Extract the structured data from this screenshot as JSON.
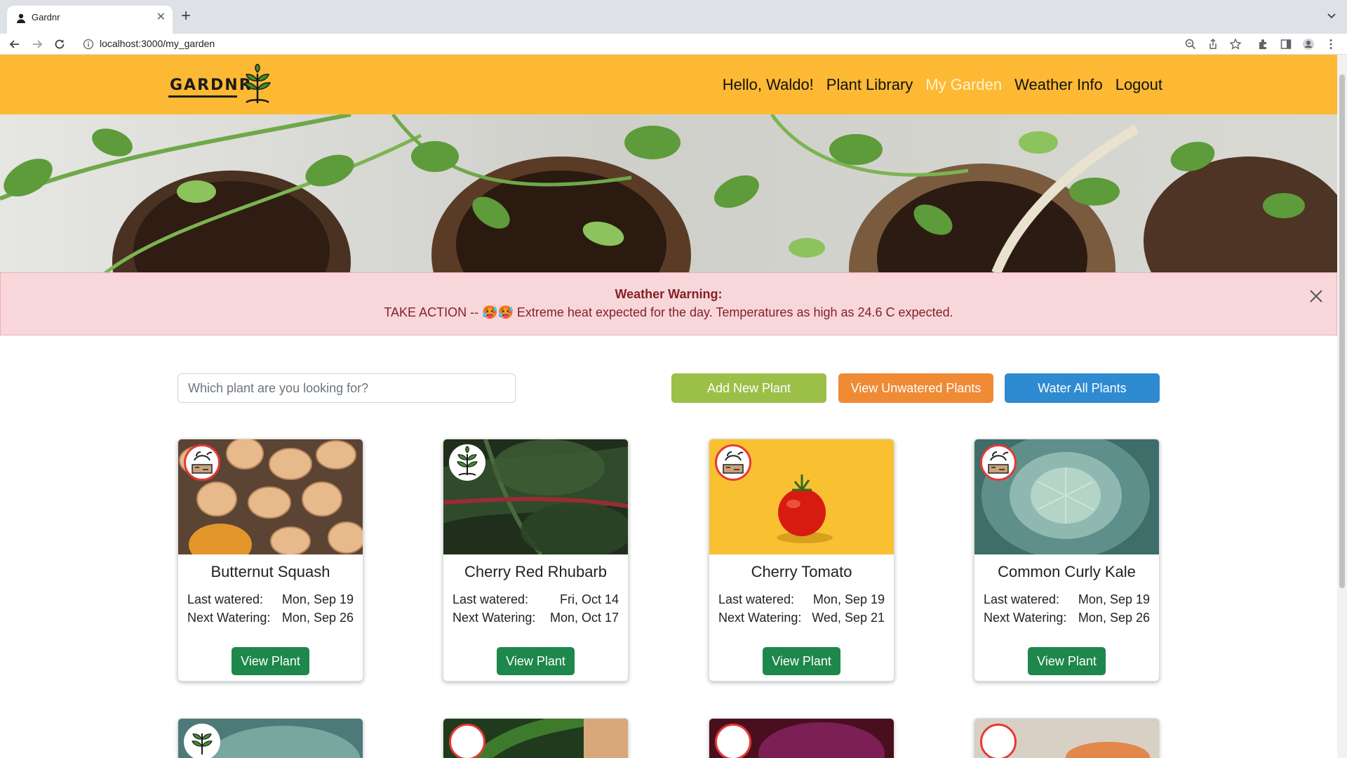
{
  "browser": {
    "tab_title": "Gardnr",
    "url": "localhost:3000/my_garden"
  },
  "navbar": {
    "brand": "GARDNR",
    "links": [
      {
        "label": "Hello, Waldo!",
        "active": false
      },
      {
        "label": "Plant Library",
        "active": false
      },
      {
        "label": "My Garden",
        "active": true
      },
      {
        "label": "Weather Info",
        "active": false
      },
      {
        "label": "Logout",
        "active": false
      }
    ]
  },
  "alert": {
    "title": "Weather Warning:",
    "message": "TAKE ACTION -- 🥵🥵 Extreme heat expected for the day. Temperatures as high as 24.6 C expected."
  },
  "search": {
    "placeholder": "Which plant are you looking for?"
  },
  "actions": {
    "add": "Add New Plant",
    "unwatered": "View Unwatered Plants",
    "water_all": "Water All Plants"
  },
  "labels": {
    "last_watered": "Last watered:",
    "next_watering": "Next Watering:",
    "view_plant": "View Plant"
  },
  "plants": [
    {
      "name": "Butternut Squash",
      "last_watered": "Mon, Sep 19",
      "next_watering": "Mon, Sep 26",
      "status": "thirsty"
    },
    {
      "name": "Cherry Red Rhubarb",
      "last_watered": "Fri, Oct 14",
      "next_watering": "Mon, Oct 17",
      "status": "healthy"
    },
    {
      "name": "Cherry Tomato",
      "last_watered": "Mon, Sep 19",
      "next_watering": "Wed, Sep 21",
      "status": "thirsty"
    },
    {
      "name": "Common Curly Kale",
      "last_watered": "Mon, Sep 19",
      "next_watering": "Mon, Sep 26",
      "status": "thirsty"
    }
  ],
  "colors": {
    "navbar": "#fdb933",
    "alert_bg": "#f8d7da",
    "alert_text": "#842029",
    "add_button": "#9cbf48",
    "unwatered_button": "#ef8a35",
    "water_button": "#2e8ad1",
    "view_button": "#1e874b"
  }
}
